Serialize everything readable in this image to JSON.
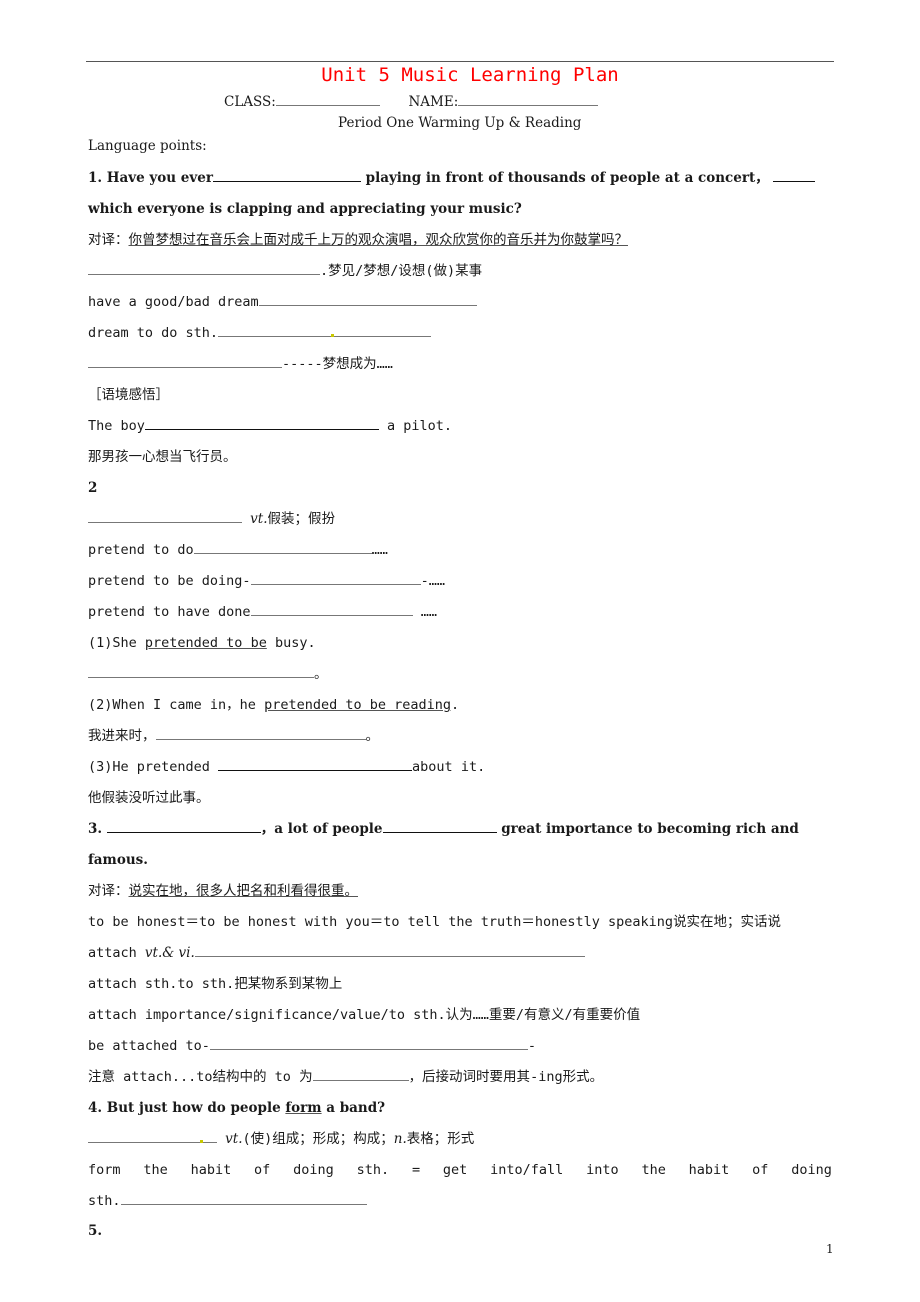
{
  "header": {
    "title": "Unit 5  Music Learning Plan",
    "class_label": "CLASS:",
    "name_label": "NAME:",
    "period": "Period One  Warming Up & Reading",
    "language_points": "Language points:"
  },
  "q1": {
    "a": "1. Have you ever",
    "b": " playing in front of thousands of people at a concert，",
    "c": "which everyone is clapping and appreciating your music?",
    "trans_label": "对译：",
    "trans": "你曾梦想过在音乐会上面对成千上万的观众演唱，观众欣赏你的音乐并为你鼓掌吗？",
    "meaning": ".梦见/梦想/设想(做)某事",
    "p1": "have a good/bad dream",
    "p2": "dream to do sth.",
    "p3": "-----梦想成为……",
    "context": "［语境感悟］",
    "ex_a": "The boy",
    "ex_b": " a pilot.",
    "ex_cn": "那男孩一心想当飞行员。"
  },
  "q2": {
    "num": "2",
    "pos": "vt.",
    "meaning": "假装；假扮",
    "p1": "pretend to do",
    "p1_end": "……",
    "p2": "pretend to be doing-",
    "p2_end": "-……",
    "p3": "pretend to have done",
    "p3_end": " ……",
    "e1_a": " (1)She ",
    "e1_u": "pretended to be",
    "e1_b": " busy.",
    "e1_end": "。",
    "e2_a": "(2)When I came in，he ",
    "e2_u": "pretended to be reading",
    "e2_b": ".",
    "e2_cn_a": "我进来时，",
    "e2_cn_end": "。",
    "e3_a": "(3)He pretended ",
    "e3_b": "about it.",
    "e3_cn": "他假装没听过此事。"
  },
  "q3": {
    "a": "3. ",
    "b": "，a lot of people",
    "c": " great importance to becoming rich and",
    "d": "famous.",
    "trans_label": "对译：",
    "trans": "说实在地，很多人把名和利看得很重。",
    "honest_a": "to be honest＝to be hones",
    "honest_b": "t with you＝to tell the truth＝honestly speaking",
    "honest_cn": "说实在地；实话说",
    "attach_a": " attach ",
    "attach_pos": "vt.& vi.",
    "a1": "attach sth.to sth.",
    "a1_cn": "把某物系到某物上",
    "a2": "attach importance/significance/value/to sth.",
    "a2_cn": "认为……重要/有意义/有重要价值",
    "a3": "be attached to-",
    "a3_end": "-",
    "note_a": "注意  attach...to",
    "note_b": "结构中的",
    "note_c": " to ",
    "note_d": "为",
    "note_e": "，后接动词时要用其",
    "note_f": "-ing",
    "note_g": "形式。"
  },
  "q4": {
    "a": "4. But just how do people ",
    "u": "form",
    "b": " a band?",
    "pos1": "vt.",
    "m1": "(使)组成；形成；构成；",
    "pos2": "n.",
    "m2": "表格；形式",
    "habit_words": [
      "form",
      "the",
      "habit",
      "of",
      "doing",
      "sth.",
      "=",
      "get",
      "into/fall",
      "into",
      "the",
      "habit",
      "of",
      "doing"
    ],
    "habit_end": "sth."
  },
  "q5": {
    "num": "5."
  },
  "footer": {
    "page": "1"
  }
}
